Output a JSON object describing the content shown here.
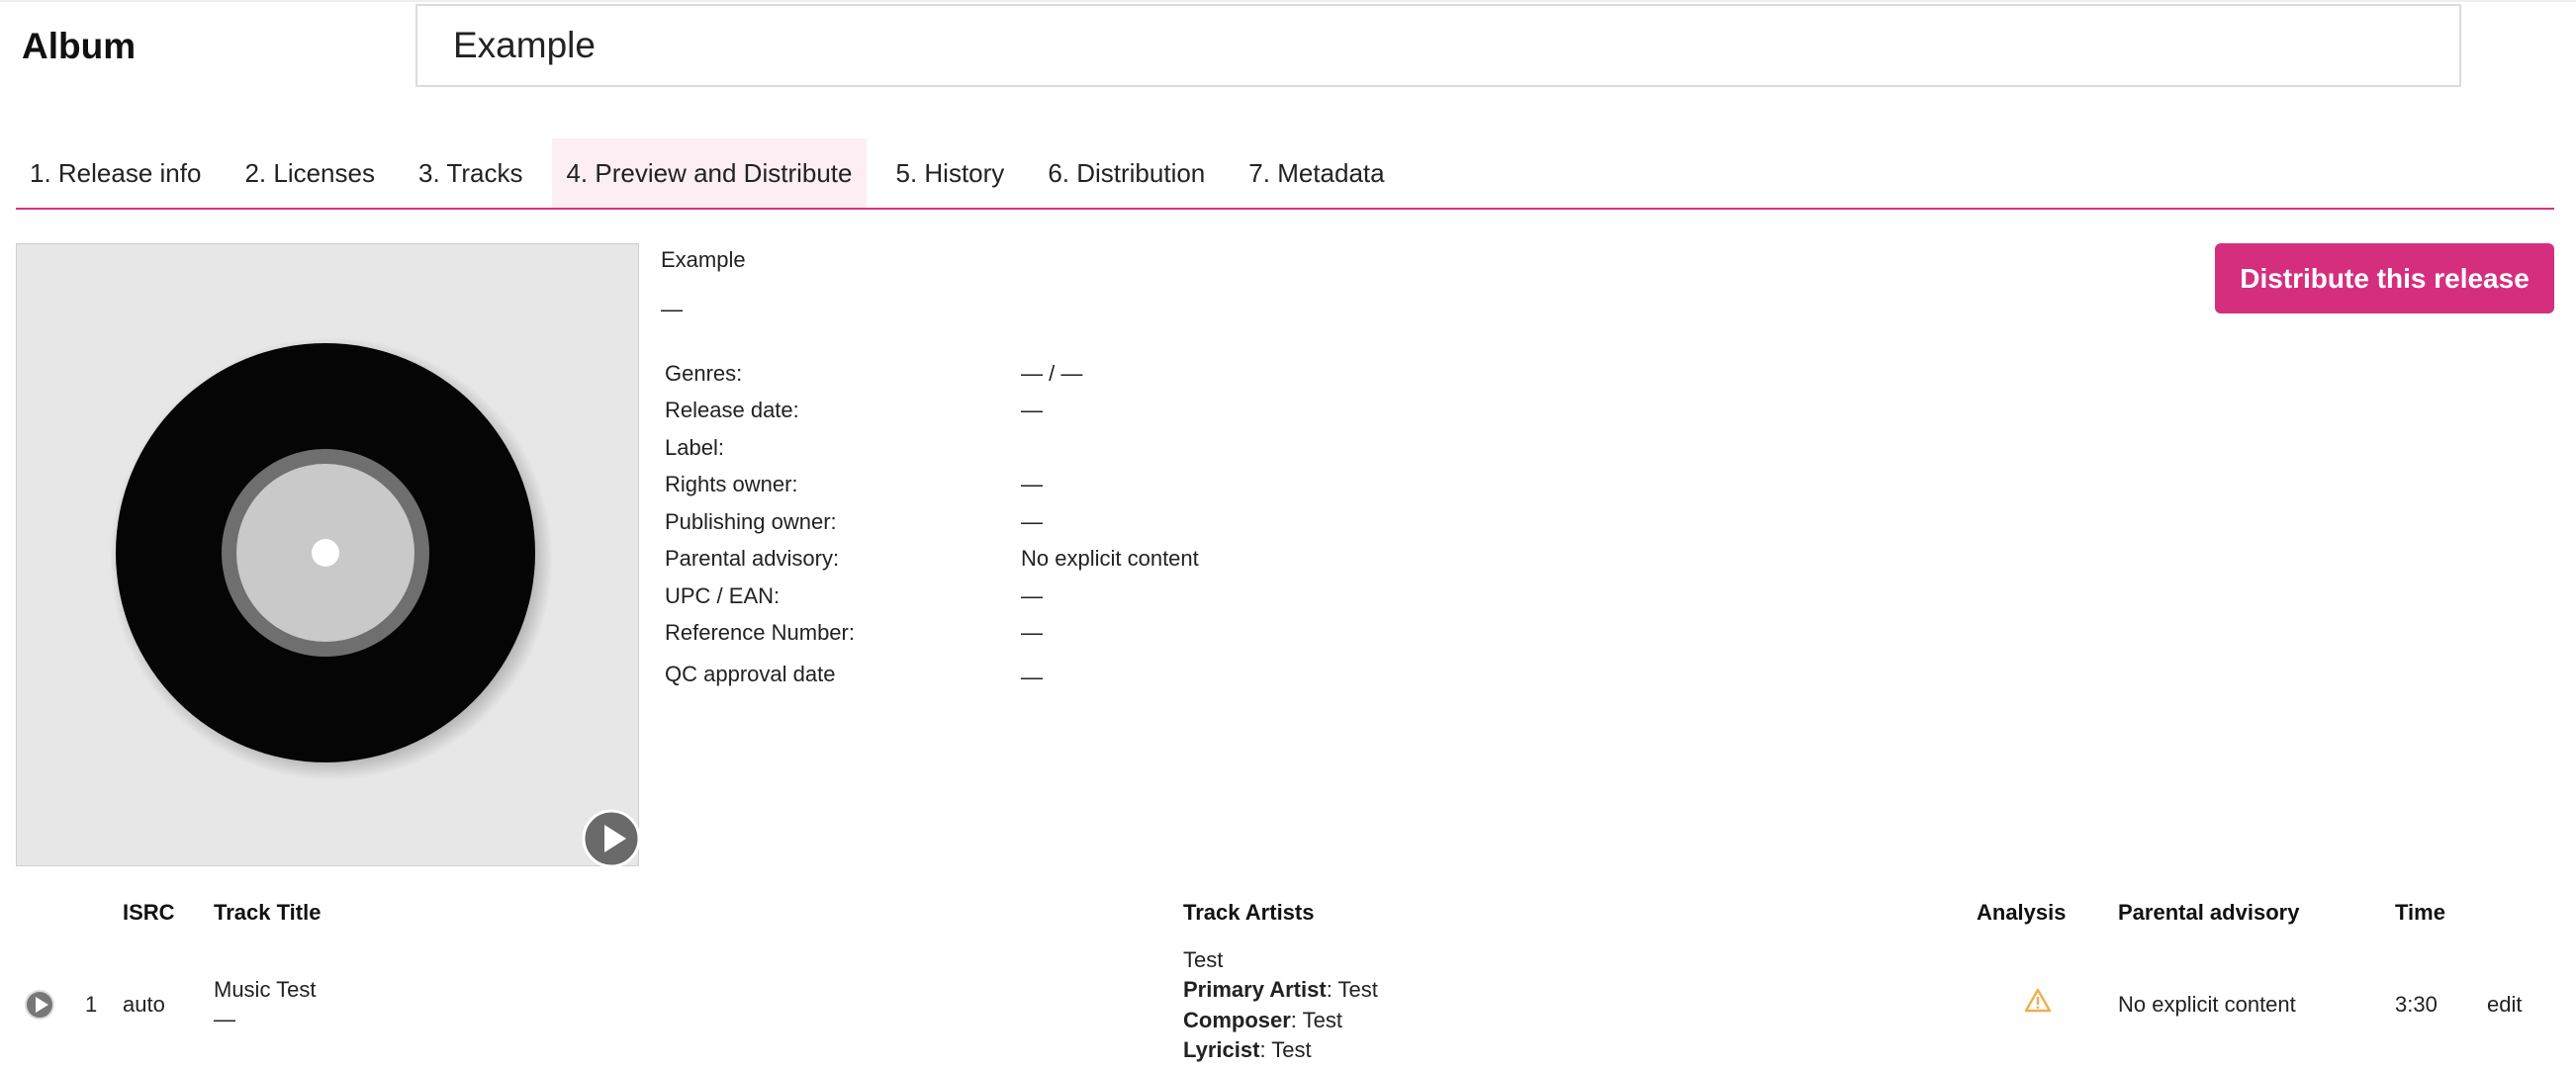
{
  "header": {
    "heading": "Album",
    "title_value": "Example"
  },
  "tabs": [
    {
      "label": "1. Release info"
    },
    {
      "label": "2. Licenses"
    },
    {
      "label": "3. Tracks"
    },
    {
      "label": "4. Preview and Distribute",
      "active": true
    },
    {
      "label": "5. History"
    },
    {
      "label": "6. Distribution"
    },
    {
      "label": "7. Metadata"
    }
  ],
  "release": {
    "name": "Example",
    "artist": "—",
    "fields": [
      {
        "label": "Genres:",
        "value": "— / —"
      },
      {
        "label": "Release date:",
        "value": "—"
      },
      {
        "label": "Label:",
        "value": ""
      },
      {
        "label": "Rights owner:",
        "value": "—"
      },
      {
        "label": "Publishing owner:",
        "value": "—"
      },
      {
        "label": "Parental advisory:",
        "value": "No explicit content"
      },
      {
        "label": "UPC / EAN:",
        "value": "—"
      },
      {
        "label": "Reference Number:",
        "value": "—"
      },
      {
        "label": "QC approval date",
        "value": "—"
      }
    ]
  },
  "actions": {
    "distribute_label": "Distribute this release"
  },
  "tracks_table": {
    "headers": {
      "isrc": "ISRC",
      "title": "Track Title",
      "artists": "Track Artists",
      "analysis": "Analysis",
      "parental": "Parental advisory",
      "time": "Time"
    },
    "rows": [
      {
        "number": "1",
        "isrc": "auto",
        "title": "Music Test",
        "subtitle": "—",
        "artist_name": "Test",
        "roles": [
          {
            "role": "Primary Artist",
            "name": ": Test"
          },
          {
            "role": "Composer",
            "name": ": Test"
          },
          {
            "role": "Lyricist",
            "name": ": Test"
          }
        ],
        "analysis_icon": "warning-icon",
        "parental": "No explicit content",
        "time": "3:30",
        "edit_label": "edit"
      }
    ]
  },
  "colors": {
    "accent": "#d62e7f",
    "tab_active_bg": "#fdeef4",
    "warning": "#f0ad4e"
  }
}
